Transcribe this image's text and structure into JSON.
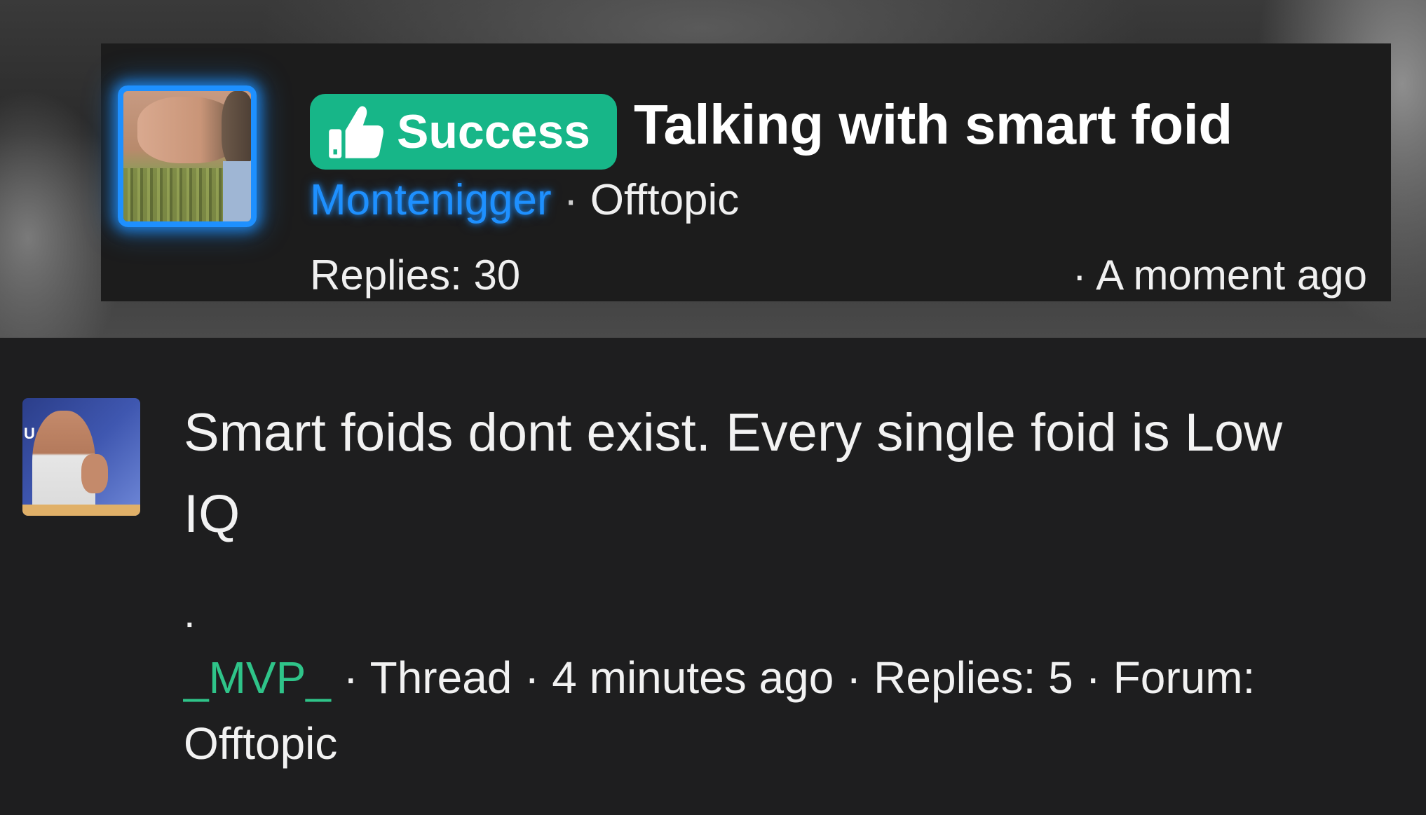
{
  "thread": {
    "badge_label": "Success",
    "title": "Talking with smart foid",
    "author": "Montenigger",
    "separator": " · ",
    "forum": "Offtopic",
    "replies": "Replies: 30",
    "time": "· A moment ago"
  },
  "post": {
    "body": "Smart foids dont exist. Every single foid is Low IQ",
    "dot": ".",
    "author": "_MVP_",
    "meta_rest": " · Thread · 4 minutes ago · Replies: 5 · Forum: Offtopic",
    "avatar_letter": "U"
  },
  "colors": {
    "badge_green": "#17b688",
    "author_blue": "#1e90ff",
    "author_green": "#2fc489",
    "background": "#1e1e1f"
  }
}
